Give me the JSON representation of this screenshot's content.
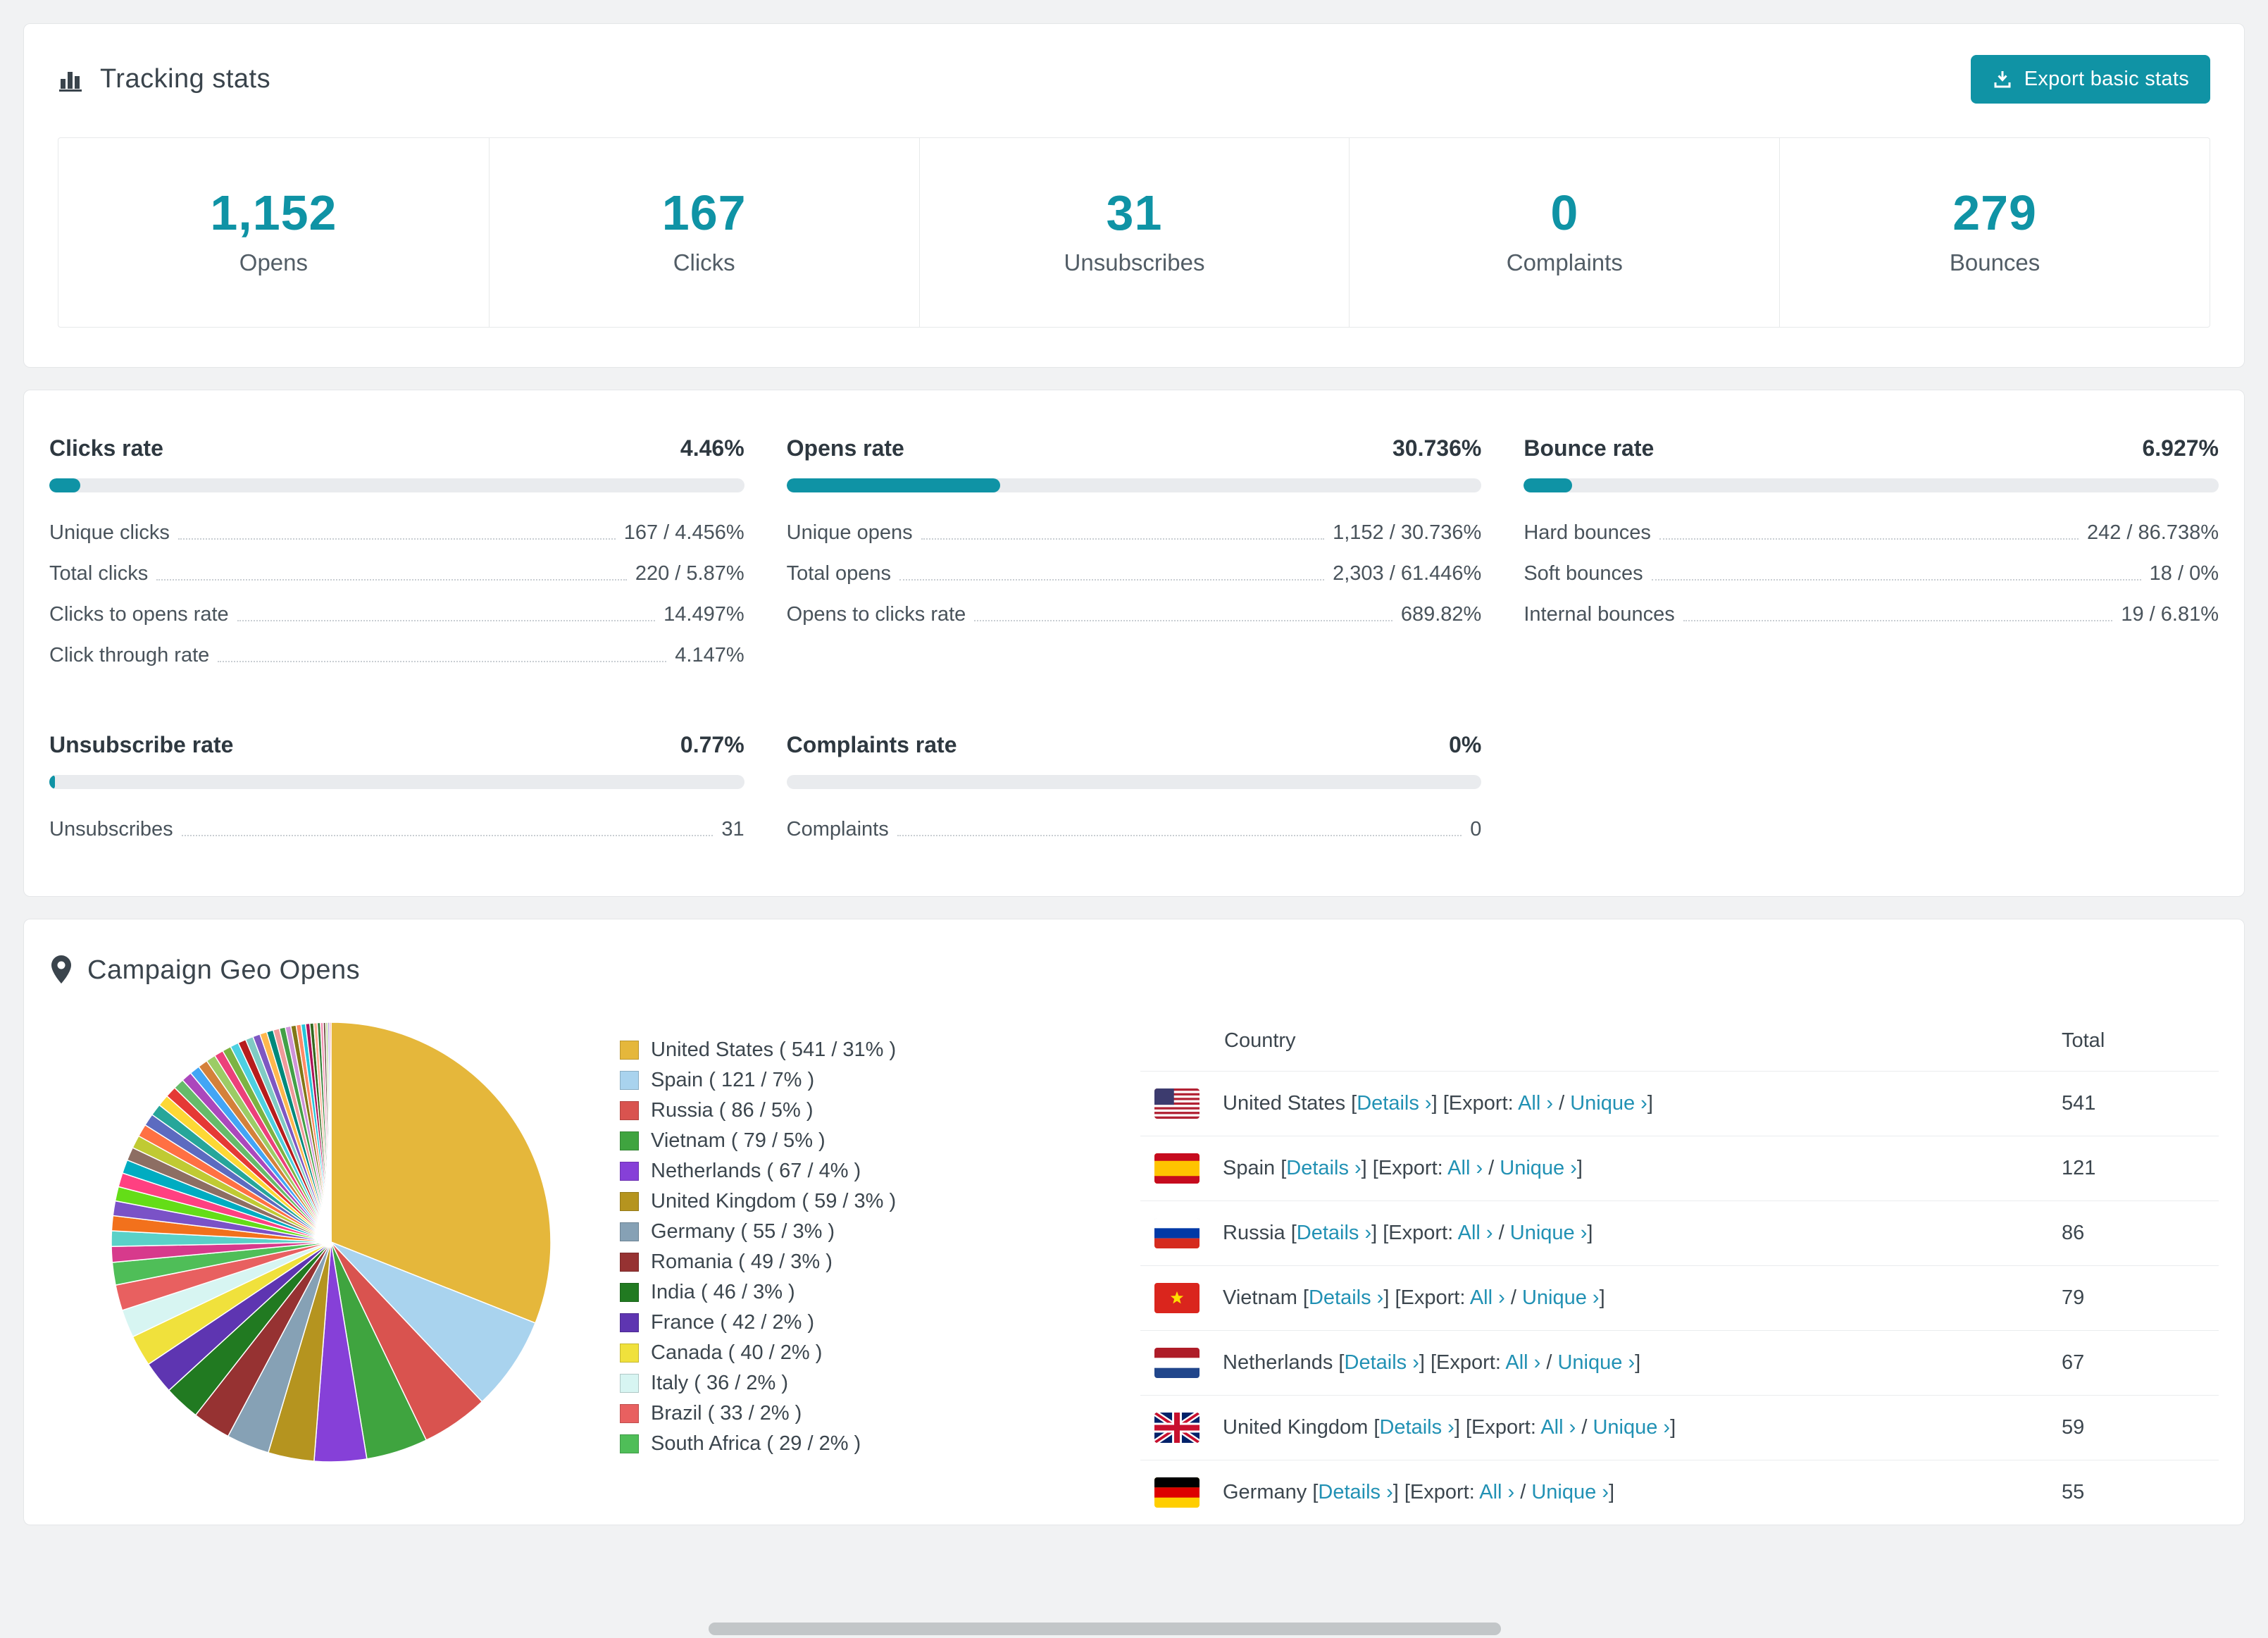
{
  "app": {
    "accent_color": "#0f93a5",
    "link_color": "#2191b4",
    "background_color": "#f1f2f3"
  },
  "tracking": {
    "title": "Tracking stats",
    "export_button": "Export basic stats",
    "stats": [
      {
        "value": "1,152",
        "label": "Opens"
      },
      {
        "value": "167",
        "label": "Clicks"
      },
      {
        "value": "31",
        "label": "Unsubscribes"
      },
      {
        "value": "0",
        "label": "Complaints"
      },
      {
        "value": "279",
        "label": "Bounces"
      }
    ]
  },
  "rates": {
    "blocks": [
      {
        "id": "clicks",
        "title": "Clicks rate",
        "value": "4.46%",
        "percent": 4.46,
        "rows": [
          {
            "label": "Unique clicks",
            "value": "167 / 4.456%"
          },
          {
            "label": "Total clicks",
            "value": "220 / 5.87%"
          },
          {
            "label": "Clicks to opens rate",
            "value": "14.497%"
          },
          {
            "label": "Click through rate",
            "value": "4.147%"
          }
        ]
      },
      {
        "id": "opens",
        "title": "Opens rate",
        "value": "30.736%",
        "percent": 30.736,
        "rows": [
          {
            "label": "Unique opens",
            "value": "1,152 / 30.736%"
          },
          {
            "label": "Total opens",
            "value": "2,303 / 61.446%"
          },
          {
            "label": "Opens to clicks rate",
            "value": "689.82%"
          }
        ]
      },
      {
        "id": "bounce",
        "title": "Bounce rate",
        "value": "6.927%",
        "percent": 6.927,
        "rows": [
          {
            "label": "Hard bounces",
            "value": "242 / 86.738%"
          },
          {
            "label": "Soft bounces",
            "value": "18 / 0%"
          },
          {
            "label": "Internal bounces",
            "value": "19 / 6.81%"
          }
        ]
      },
      {
        "id": "unsubscribe",
        "title": "Unsubscribe rate",
        "value": "0.77%",
        "percent": 0.77,
        "rows": [
          {
            "label": "Unsubscribes",
            "value": "31"
          }
        ]
      },
      {
        "id": "complaints",
        "title": "Complaints rate",
        "value": "0%",
        "percent": 0,
        "rows": [
          {
            "label": "Complaints",
            "value": "0"
          }
        ]
      }
    ]
  },
  "geo": {
    "title": "Campaign Geo Opens",
    "table": {
      "headers": [
        "Country",
        "Total"
      ],
      "details_label": "Details ›",
      "export_prefix": "Export:",
      "all_label": "All ›",
      "unique_label": "Unique ›",
      "rows": [
        {
          "country": "United States",
          "flag": "us",
          "total": "541"
        },
        {
          "country": "Spain",
          "flag": "es",
          "total": "121"
        },
        {
          "country": "Russia",
          "flag": "ru",
          "total": "86"
        },
        {
          "country": "Vietnam",
          "flag": "vn",
          "total": "79"
        },
        {
          "country": "Netherlands",
          "flag": "nl",
          "total": "67"
        },
        {
          "country": "United Kingdom",
          "flag": "gb",
          "total": "59"
        },
        {
          "country": "Germany",
          "flag": "de",
          "total": "55"
        }
      ]
    }
  },
  "chart_data": {
    "type": "pie",
    "title": "Campaign Geo Opens",
    "legend_position": "right",
    "slices": [
      {
        "label": "United States",
        "value": 541,
        "percent": 31,
        "color": "#e5b73b"
      },
      {
        "label": "Spain",
        "value": 121,
        "percent": 7,
        "color": "#a9d3ee"
      },
      {
        "label": "Russia",
        "value": 86,
        "percent": 5,
        "color": "#d9534f"
      },
      {
        "label": "Vietnam",
        "value": 79,
        "percent": 5,
        "color": "#3fa43f"
      },
      {
        "label": "Netherlands",
        "value": 67,
        "percent": 4,
        "color": "#8640d8"
      },
      {
        "label": "United Kingdom",
        "value": 59,
        "percent": 3,
        "color": "#b5941f"
      },
      {
        "label": "Germany",
        "value": 55,
        "percent": 3,
        "color": "#86a1b5"
      },
      {
        "label": "Romania",
        "value": 49,
        "percent": 3,
        "color": "#963232"
      },
      {
        "label": "India",
        "value": 46,
        "percent": 3,
        "color": "#217a21"
      },
      {
        "label": "France",
        "value": 42,
        "percent": 2,
        "color": "#5e35b1"
      },
      {
        "label": "Canada",
        "value": 40,
        "percent": 2,
        "color": "#f0e13c"
      },
      {
        "label": "Italy",
        "value": 36,
        "percent": 2,
        "color": "#d7f5f2"
      },
      {
        "label": "Brazil",
        "value": 33,
        "percent": 2,
        "color": "#e86060"
      },
      {
        "label": "South Africa",
        "value": 29,
        "percent": 2,
        "color": "#4fbe58"
      }
    ],
    "others_total_value": 462,
    "others_colors": [
      "#d73a8c",
      "#5ad1c8",
      "#f2711c",
      "#7a52c7",
      "#64dd17",
      "#ff4081",
      "#00acc1",
      "#8d6e63",
      "#c0ca33",
      "#ff7043",
      "#5c6bc0",
      "#26a69a",
      "#fdd835",
      "#e53935",
      "#66bb6a",
      "#ab47bc",
      "#42a5f5",
      "#d4813a",
      "#9ccc65",
      "#ec407a",
      "#7cb342",
      "#4dd0e1",
      "#b71c1c",
      "#80cbc4",
      "#7e57c2",
      "#ffb74d",
      "#00897b",
      "#ef9a9a",
      "#43a047",
      "#ce93d8",
      "#827717",
      "#ff8a65",
      "#26c6da",
      "#ad1457",
      "#33691e",
      "#ffab91",
      "#2e7d32",
      "#f48fb1",
      "#6d4c41",
      "#aed581",
      "#9575cd",
      "#ef5350"
    ]
  }
}
